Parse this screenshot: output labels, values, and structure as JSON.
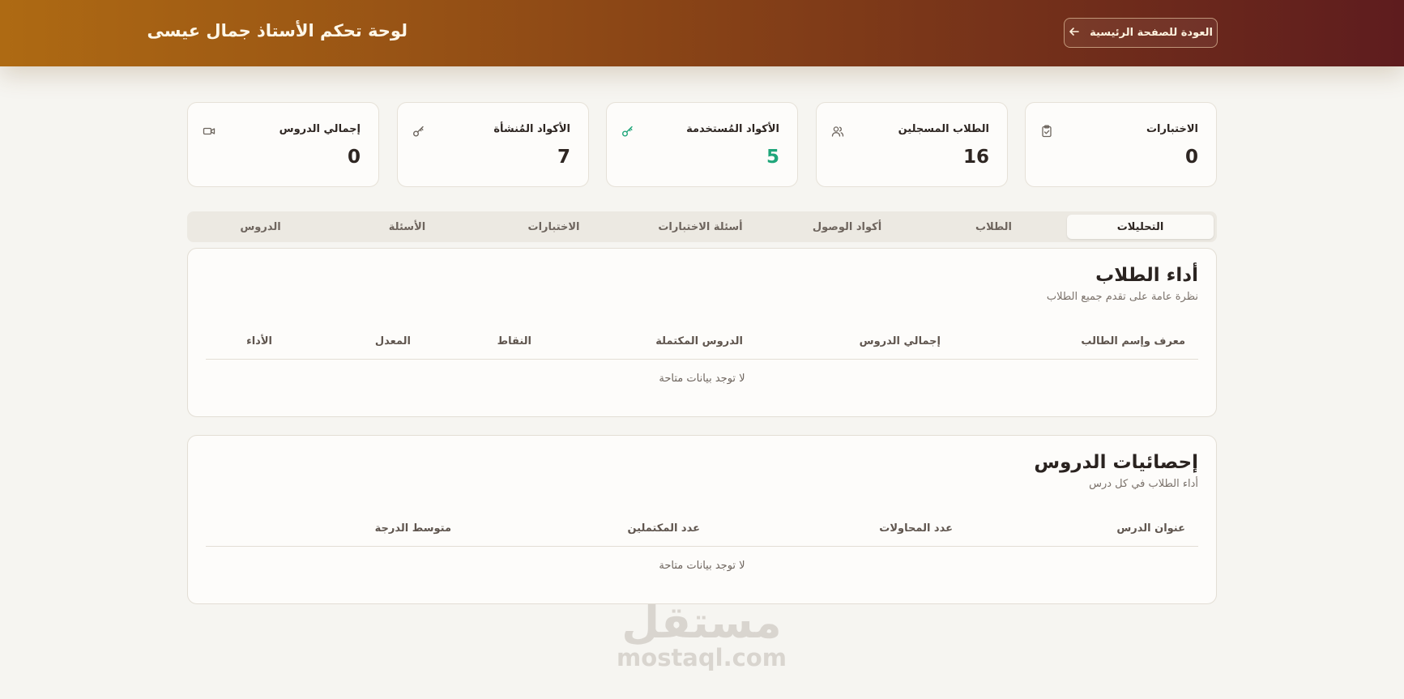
{
  "header": {
    "title": "لوحة تحكم الأستاذ جمال عيسى",
    "back_label": "العودة للصفحة الرئيسية"
  },
  "stats": [
    {
      "label": "الاختبارات",
      "value": "0",
      "icon": "clipboard-check-icon"
    },
    {
      "label": "الطلاب المسجلين",
      "value": "16",
      "icon": "users-icon"
    },
    {
      "label": "الأكواد المُستخدمة",
      "value": "5",
      "icon": "key-icon",
      "accent": "#1fa67a"
    },
    {
      "label": "الأكواد المُنشأة",
      "value": "7",
      "icon": "key-icon"
    },
    {
      "label": "إجمالي الدروس",
      "value": "0",
      "icon": "video-icon"
    }
  ],
  "tabs": [
    {
      "label": "التحليلات",
      "active": true
    },
    {
      "label": "الطلاب"
    },
    {
      "label": "أكواد الوصول"
    },
    {
      "label": "أسئلة الاختبارات"
    },
    {
      "label": "الاختبارات"
    },
    {
      "label": "الأسئلة"
    },
    {
      "label": "الدروس"
    }
  ],
  "students_panel": {
    "title": "أداء الطلاب",
    "subtitle": "نظرة عامة على تقدم جميع الطلاب",
    "columns": [
      "معرف وإسم الطالب",
      "إجمالي الدروس",
      "الدروس المكتملة",
      "النقاط",
      "المعدل",
      "الأداء"
    ],
    "empty": "لا توجد بيانات متاحة"
  },
  "lessons_panel": {
    "title": "إحصائيات الدروس",
    "subtitle": "أداء الطلاب في كل درس",
    "columns": [
      "عنوان الدرس",
      "عدد المحاولات",
      "عدد المكتملين",
      "متوسط الدرجة"
    ],
    "empty": "لا توجد بيانات متاحة"
  },
  "watermark": {
    "arabic": "مستقل",
    "latin": "mostaql.com"
  }
}
